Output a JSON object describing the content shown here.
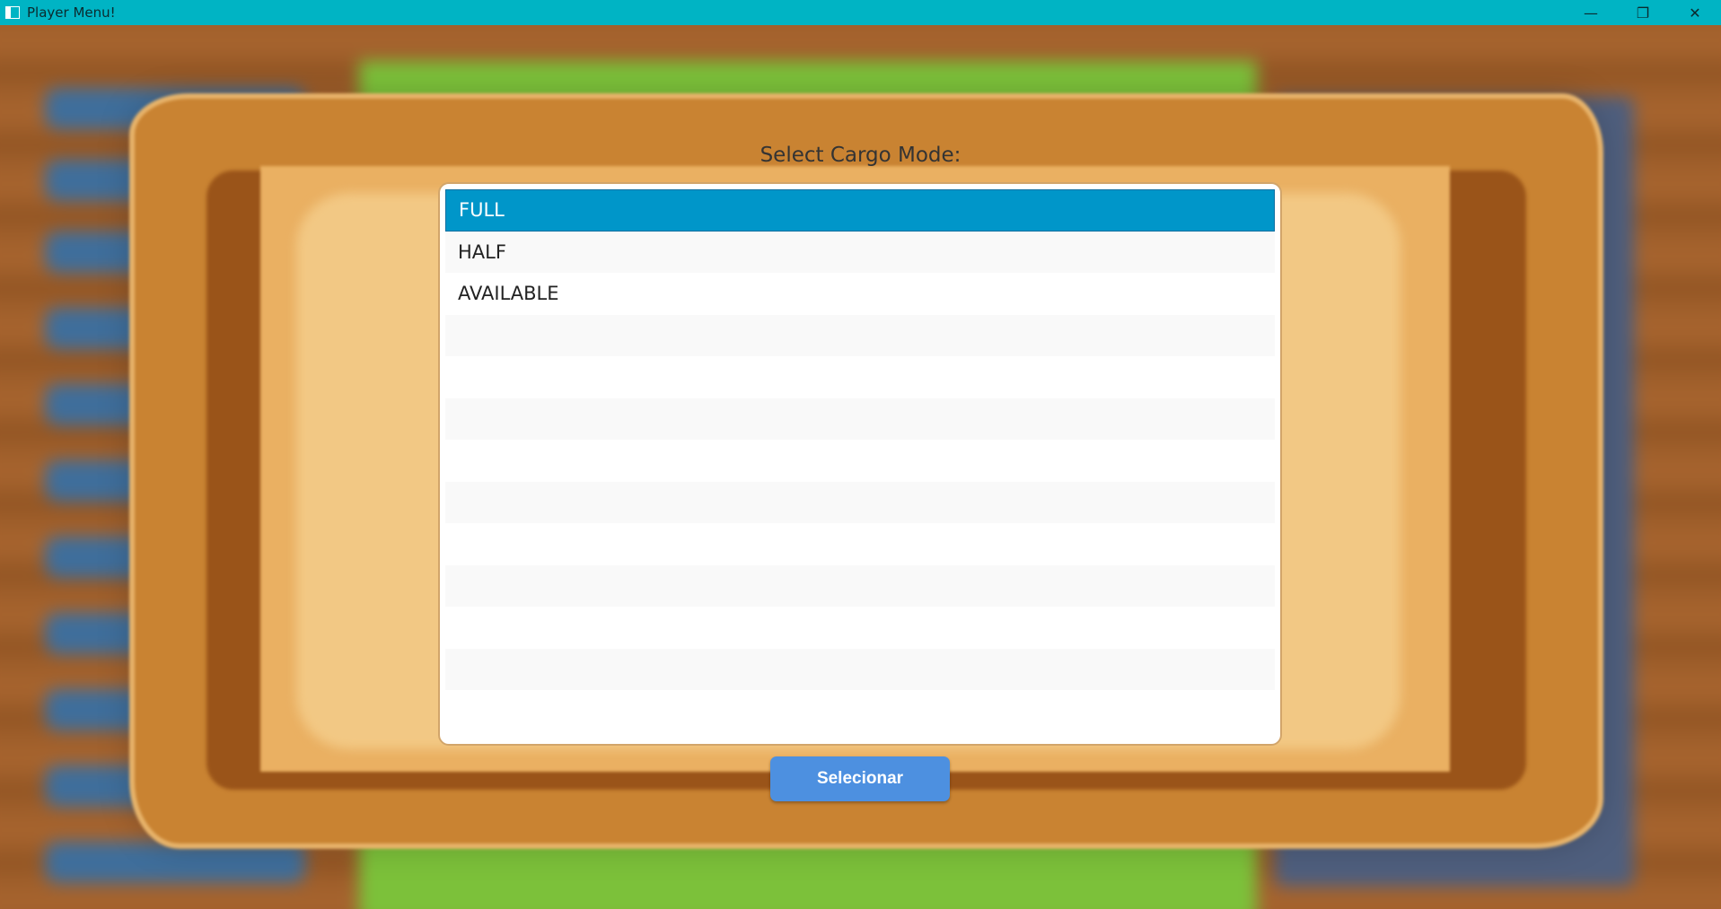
{
  "window": {
    "title": "Player Menu!",
    "title_bar_color": "#00b4c4",
    "controls": {
      "minimize": "—",
      "restore": "❐",
      "close": "✕"
    }
  },
  "dialog": {
    "label": "Select Cargo Mode:",
    "options": [
      {
        "label": "FULL",
        "selected": true
      },
      {
        "label": "HALF",
        "selected": false
      },
      {
        "label": "AVAILABLE",
        "selected": false
      }
    ],
    "empty_row_count": 14,
    "button_label": "Selecionar"
  },
  "colors": {
    "selection": "#0096c9",
    "button": "#4d90e0",
    "parchment": "#eab062",
    "frame": "#c98332"
  }
}
